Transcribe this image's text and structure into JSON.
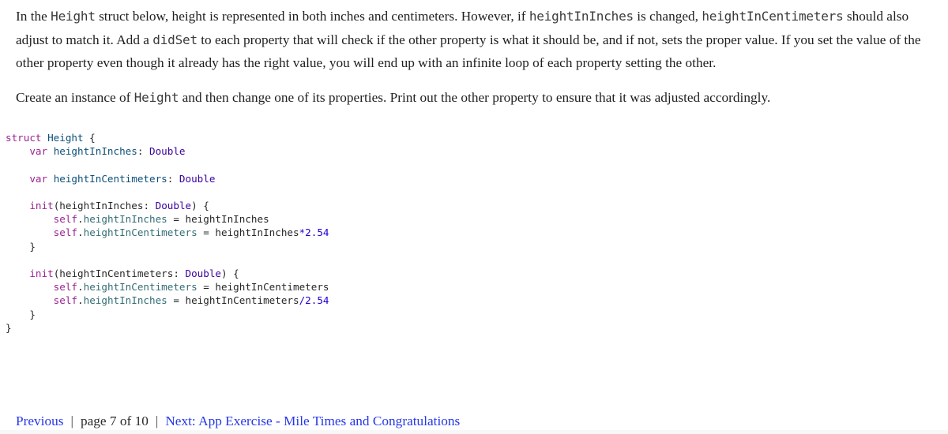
{
  "instructions": {
    "paragraph1": {
      "t1": "In the ",
      "c1": "Height",
      "t2": " struct below, height is represented in both inches and centimeters. However, if ",
      "c2": "heightInInches",
      "t3": " is changed, ",
      "c3": "heightInCentimeters",
      "t4": " should also adjust to match it. Add a ",
      "c4": "didSet",
      "t5": " to each property that will check if the other property is what it should be, and if not, sets the proper value. If you set the value of the other property even though it already has the right value, you will end up with an infinite loop of each property setting the other."
    },
    "paragraph2": {
      "t1": "Create an instance of ",
      "c1": "Height",
      "t2": " and then change one of its properties. Print out the other property to ensure that it was adjusted accordingly."
    }
  },
  "code": {
    "kw_struct": "struct",
    "type_name": "Height",
    "kw_var": "var",
    "kw_init": "init",
    "kw_self": "self",
    "prop_inches": "heightInInches",
    "prop_cm": "heightInCentimeters",
    "type_double": "Double",
    "number": "2.54",
    "op_mul": "*",
    "op_div": "/"
  },
  "footer": {
    "previous_label": "Previous",
    "separator": "|",
    "page_label": "page 7 of 10",
    "next_label": "Next: App Exercise - Mile Times and Congratulations"
  }
}
